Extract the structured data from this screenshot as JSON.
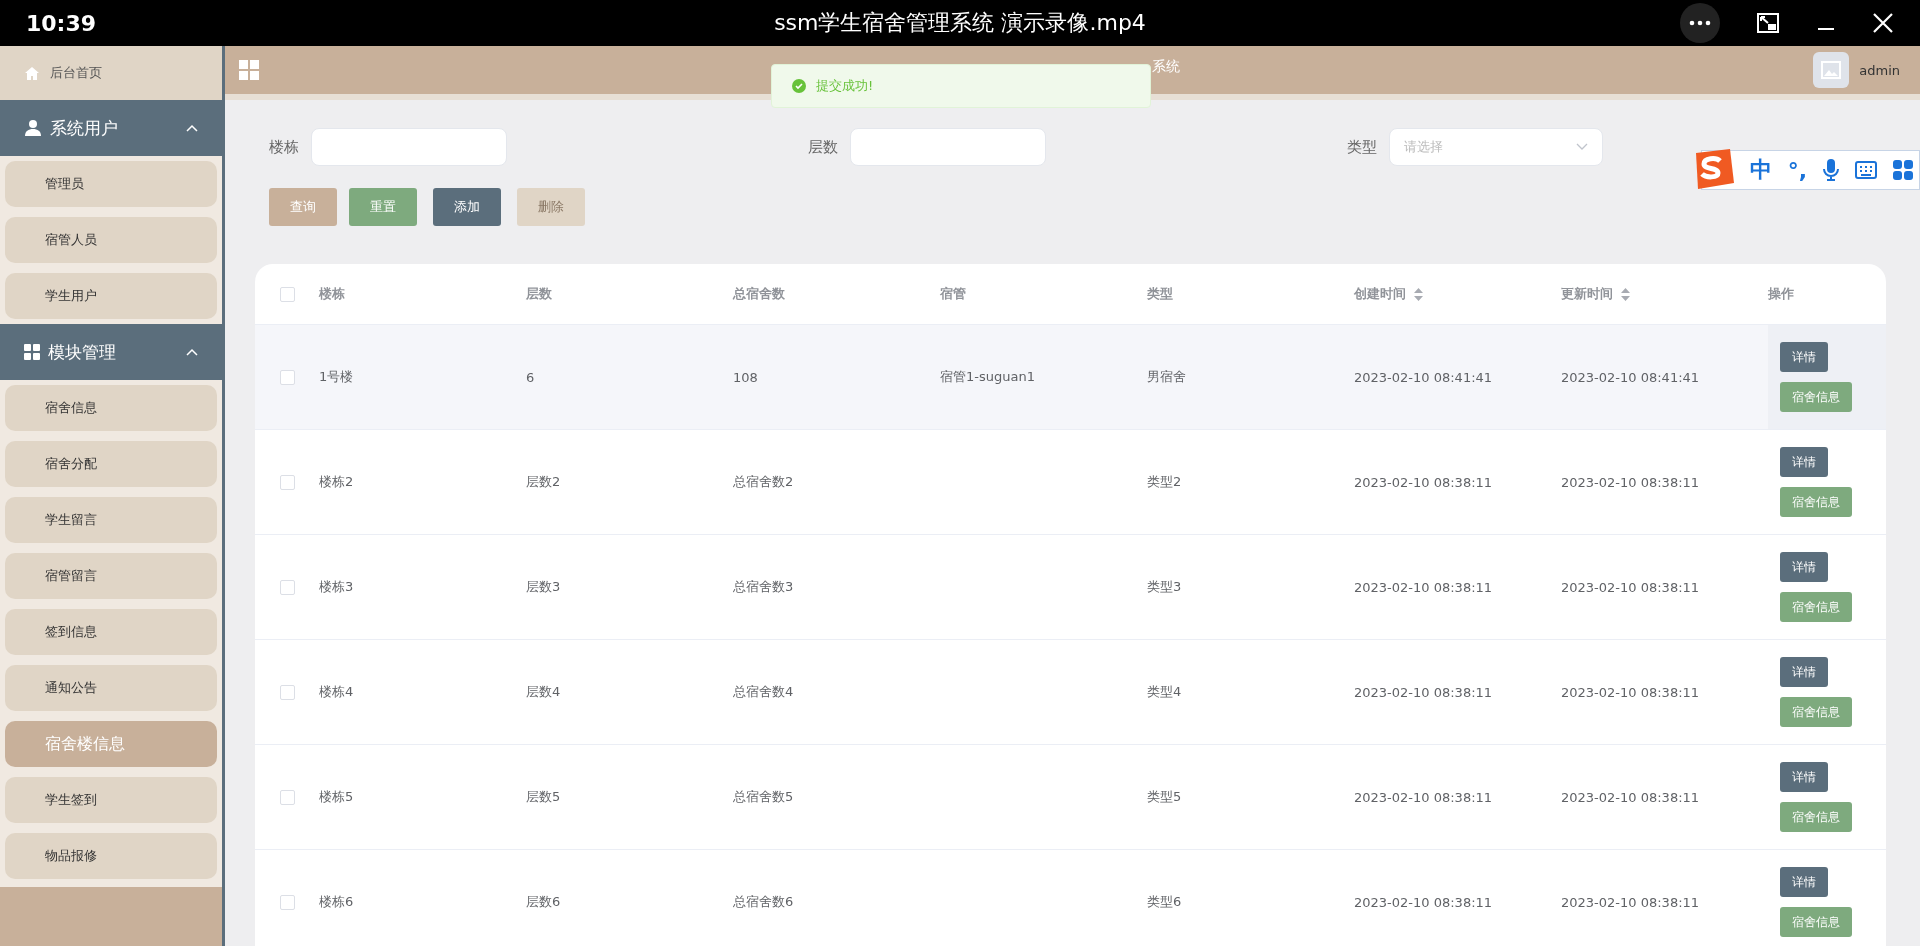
{
  "player": {
    "time": "10:39",
    "title": "ssm学生宿舍管理系统 演示录像.mp4"
  },
  "sidebar": {
    "home": "后台首页",
    "groups": [
      {
        "title": "系统用户",
        "expanded": true,
        "items": [
          {
            "label": "管理员",
            "selected": false
          },
          {
            "label": "宿管人员",
            "selected": false
          },
          {
            "label": "学生用户",
            "selected": false
          }
        ]
      },
      {
        "title": "模块管理",
        "expanded": true,
        "items": [
          {
            "label": "宿舍信息",
            "selected": false
          },
          {
            "label": "宿舍分配",
            "selected": false
          },
          {
            "label": "学生留言",
            "selected": false
          },
          {
            "label": "宿管留言",
            "selected": false
          },
          {
            "label": "签到信息",
            "selected": false
          },
          {
            "label": "通知公告",
            "selected": false
          },
          {
            "label": "宿舍楼信息",
            "selected": true
          },
          {
            "label": "学生签到",
            "selected": false
          },
          {
            "label": "物品报修",
            "selected": false
          }
        ]
      }
    ]
  },
  "header": {
    "title_visible": "系统",
    "user": "admin"
  },
  "toast": {
    "message": "提交成功!"
  },
  "filters": [
    {
      "label": "楼栋",
      "kind": "input"
    },
    {
      "label": "层数",
      "kind": "input"
    },
    {
      "label": "类型",
      "kind": "select",
      "placeholder": "请选择"
    }
  ],
  "actions": [
    {
      "label": "查询",
      "kind": "query"
    },
    {
      "label": "重置",
      "kind": "reset"
    },
    {
      "label": "添加",
      "kind": "add"
    },
    {
      "label": "删除",
      "kind": "delete"
    }
  ],
  "ime": {
    "mode": "中",
    "punct": "°,"
  },
  "table": {
    "all_checked": false,
    "columns": [
      {
        "label": "楼栋",
        "sortable": false
      },
      {
        "label": "层数",
        "sortable": false
      },
      {
        "label": "总宿舍数",
        "sortable": false
      },
      {
        "label": "宿管",
        "sortable": false
      },
      {
        "label": "类型",
        "sortable": false
      },
      {
        "label": "创建时间",
        "sortable": true
      },
      {
        "label": "更新时间",
        "sortable": true
      },
      {
        "label": "操作",
        "sortable": false
      }
    ],
    "rows": [
      {
        "cells": [
          "1号楼",
          "6",
          "108",
          "宿管1-suguan1",
          "男宿舍",
          "2023-02-10 08:41:41",
          "2023-02-10 08:41:41"
        ],
        "buttons": [
          "详情",
          "宿舍信息"
        ],
        "highlighted": true,
        "checked": false
      },
      {
        "cells": [
          "楼栋2",
          "层数2",
          "总宿舍数2",
          "",
          "类型2",
          "2023-02-10 08:38:11",
          "2023-02-10 08:38:11"
        ],
        "buttons": [
          "详情",
          "宿舍信息"
        ],
        "highlighted": false,
        "checked": false
      },
      {
        "cells": [
          "楼栋3",
          "层数3",
          "总宿舍数3",
          "",
          "类型3",
          "2023-02-10 08:38:11",
          "2023-02-10 08:38:11"
        ],
        "buttons": [
          "详情",
          "宿舍信息"
        ],
        "highlighted": false,
        "checked": false
      },
      {
        "cells": [
          "楼栋4",
          "层数4",
          "总宿舍数4",
          "",
          "类型4",
          "2023-02-10 08:38:11",
          "2023-02-10 08:38:11"
        ],
        "buttons": [
          "详情",
          "宿舍信息"
        ],
        "highlighted": false,
        "checked": false
      },
      {
        "cells": [
          "楼栋5",
          "层数5",
          "总宿舍数5",
          "",
          "类型5",
          "2023-02-10 08:38:11",
          "2023-02-10 08:38:11"
        ],
        "buttons": [
          "详情",
          "宿舍信息"
        ],
        "highlighted": false,
        "checked": false
      },
      {
        "cells": [
          "楼栋6",
          "层数6",
          "总宿舍数6",
          "",
          "类型6",
          "2023-02-10 08:38:11",
          "2023-02-10 08:38:11"
        ],
        "buttons": [
          "详情",
          "宿舍信息"
        ],
        "highlighted": false,
        "checked": false
      }
    ]
  }
}
